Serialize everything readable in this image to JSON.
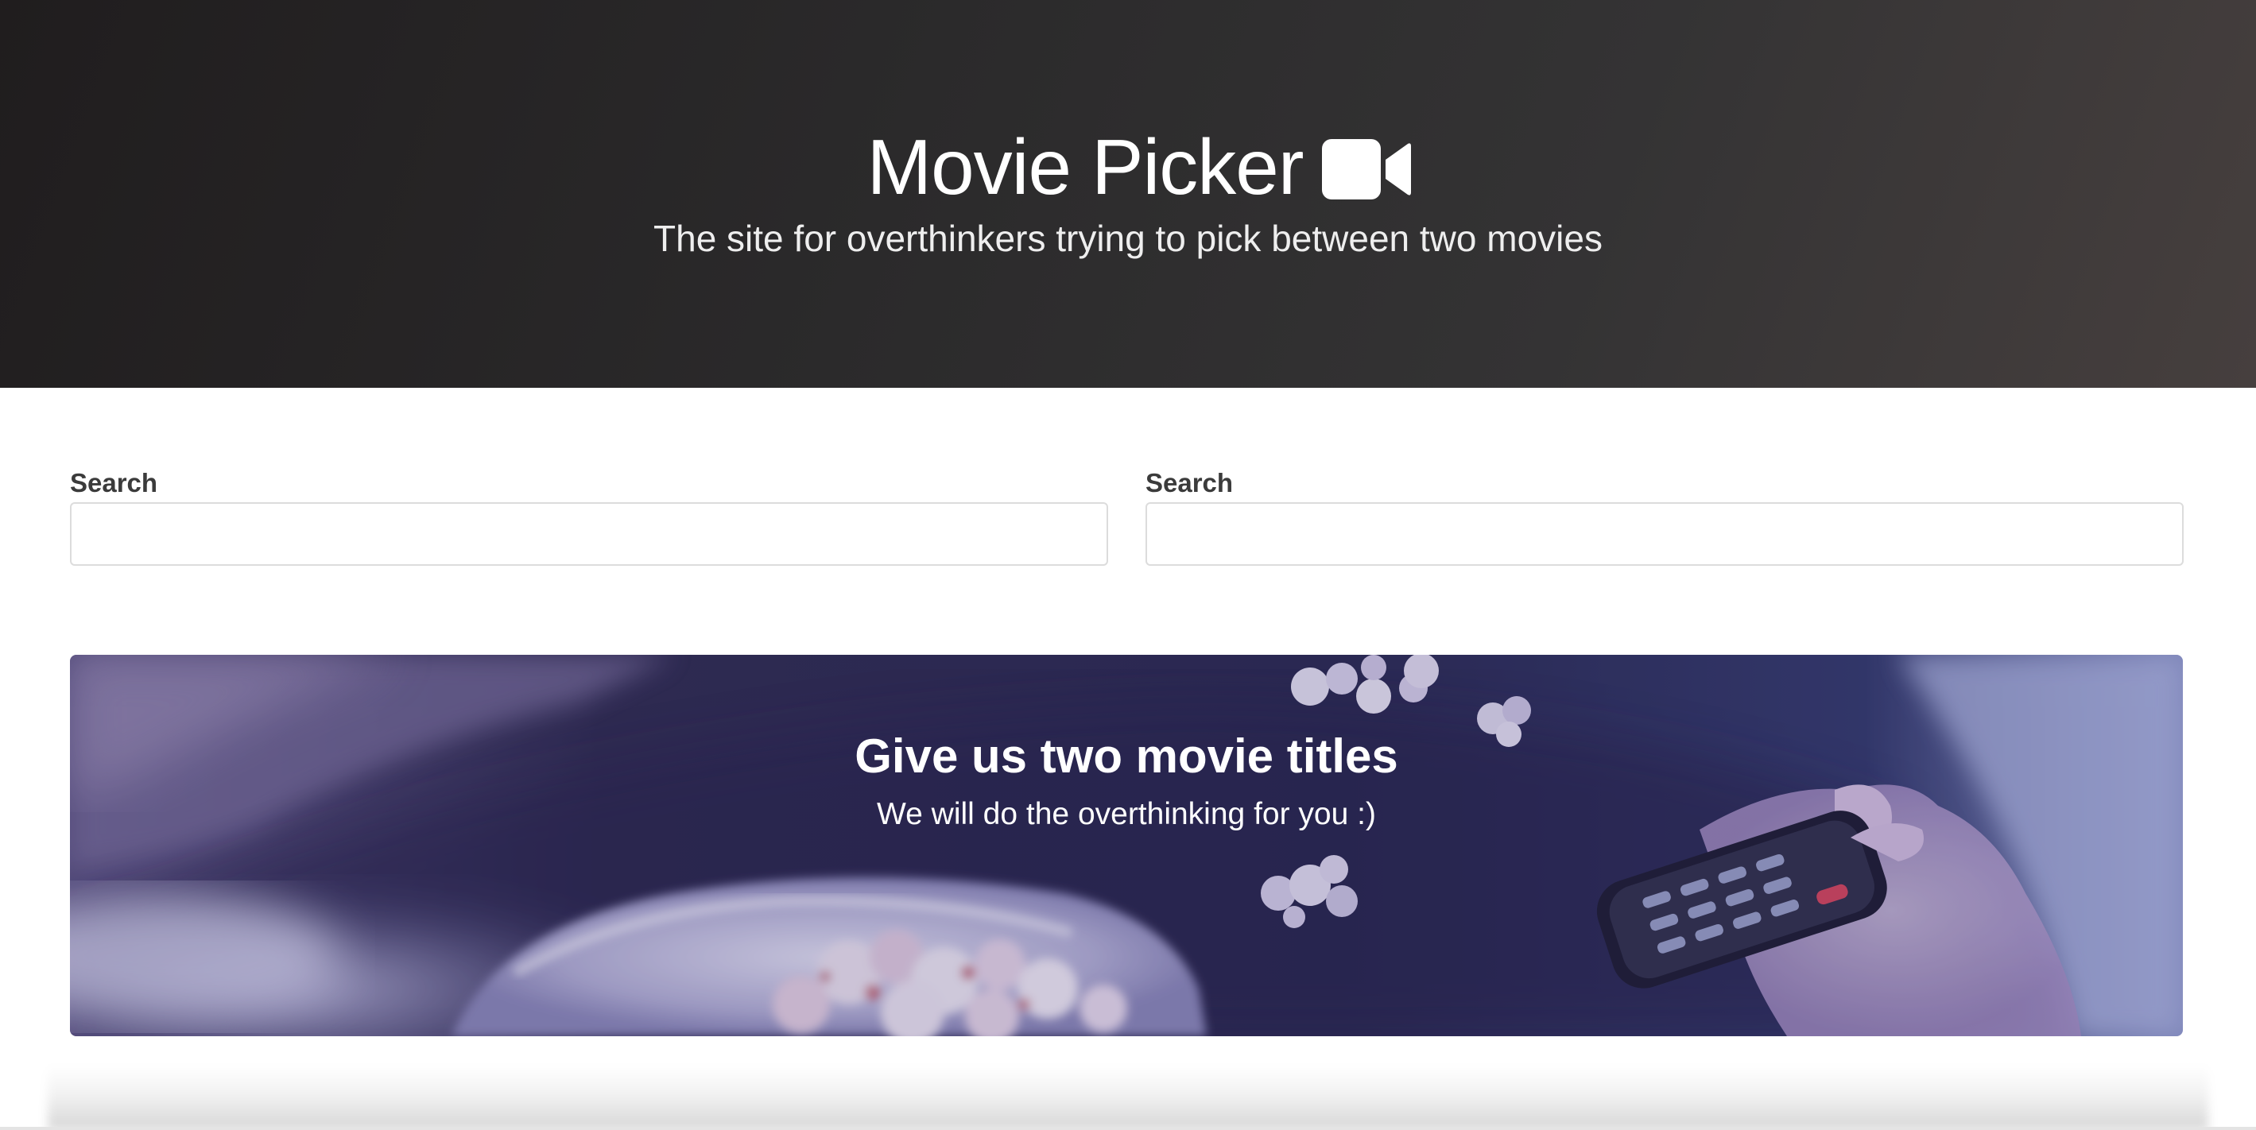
{
  "header": {
    "title": "Movie Picker",
    "icon": "video-camera-icon",
    "subtitle": "The site for overthinkers trying to pick between two movies"
  },
  "search": {
    "left": {
      "label": "Search",
      "value": "",
      "placeholder": ""
    },
    "right": {
      "label": "Search",
      "value": "",
      "placeholder": ""
    }
  },
  "banner": {
    "title": "Give us two movie titles",
    "subtitle": "We will do the overthinking for you :)"
  },
  "colors": {
    "header_bg": "#2b2a2b",
    "text_white": "#ffffff",
    "label_text": "#3b3b3b",
    "input_border": "#dcdcdc",
    "banner_tint": "#3a3663"
  }
}
